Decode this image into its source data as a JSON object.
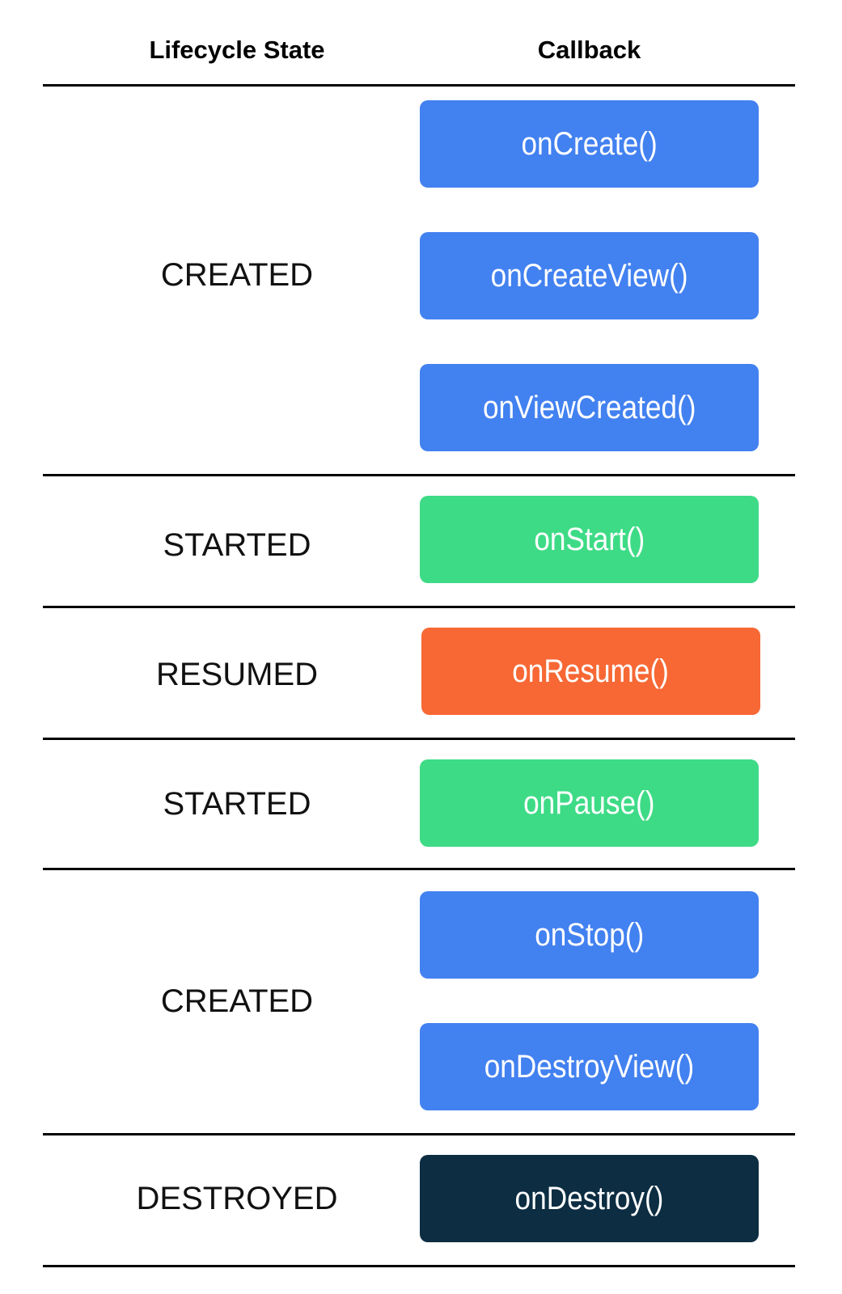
{
  "header": {
    "state": "Lifecycle State",
    "callback": "Callback"
  },
  "colors": {
    "created": "#4281F0",
    "started": "#3EDB86",
    "resumed": "#F76835",
    "destroyed": "#0C2D42"
  },
  "states": [
    "CREATED",
    "STARTED",
    "RESUMED",
    "STARTED",
    "CREATED",
    "DESTROYED"
  ],
  "callbacks": [
    "onCreate()",
    "onCreateView()",
    "onViewCreated()",
    "onStart()",
    "onResume()",
    "onPause()",
    "onStop()",
    "onDestroyView()",
    "onDestroy()"
  ]
}
